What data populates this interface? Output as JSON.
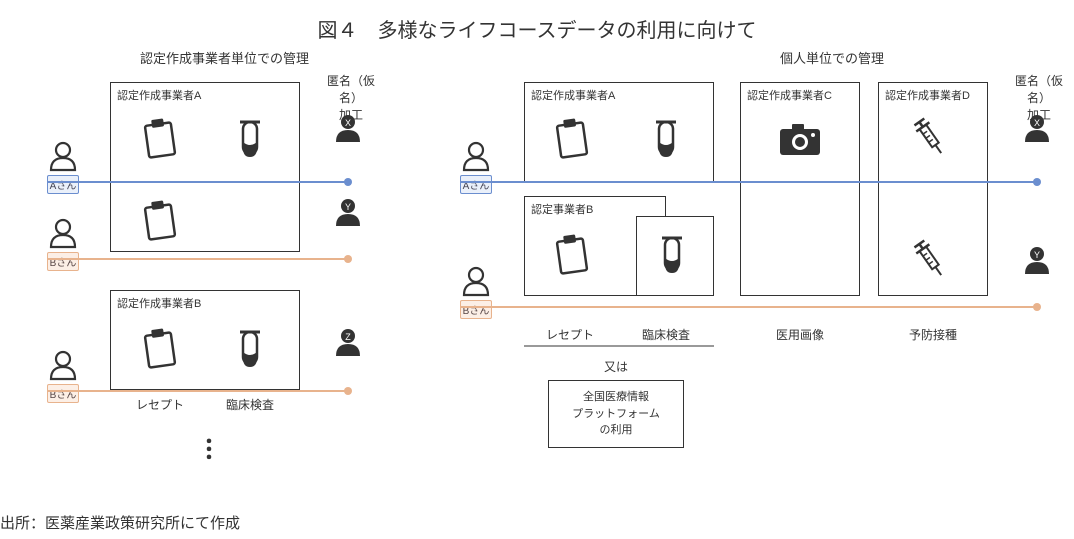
{
  "title": "図４　多様なライフコースデータの利用に向けて",
  "left": {
    "subtitle": "認定作成事業者単位での管理",
    "boxA": "認定作成事業者A",
    "boxB": "認定作成事業者B",
    "anon": "匿名（仮名）\n加工",
    "personA": "Aさん",
    "personB": "Bさん",
    "cat_receipt": "レセプト",
    "cat_clinical": "臨床検査"
  },
  "right": {
    "subtitle": "個人単位での管理",
    "boxA": "認定作成事業者A",
    "boxB": "認定事業者B",
    "boxC": "認定作成事業者C",
    "boxD": "認定作成事業者D",
    "anon": "匿名（仮名）\n加工",
    "personA": "Aさん",
    "personB": "Bさん",
    "cat_receipt": "レセプト",
    "cat_clinical": "臨床検査",
    "cat_image": "医用画像",
    "cat_vaccine": "予防接種",
    "or": "又は",
    "platform": "全国医療情報\nプラットフォーム\nの利用"
  },
  "source": "出所：医薬産業政策研究所にて作成",
  "icons": {
    "person": "person-icon",
    "clipboard": "clipboard-icon",
    "testtube": "testtube-icon",
    "camera": "camera-icon",
    "syringe": "syringe-icon"
  },
  "anon_labels": {
    "x": "X",
    "y": "Y",
    "z": "Z"
  },
  "colors": {
    "lineA": "#6b8ecf",
    "lineB": "#e8b38d",
    "rule": "#333333"
  }
}
